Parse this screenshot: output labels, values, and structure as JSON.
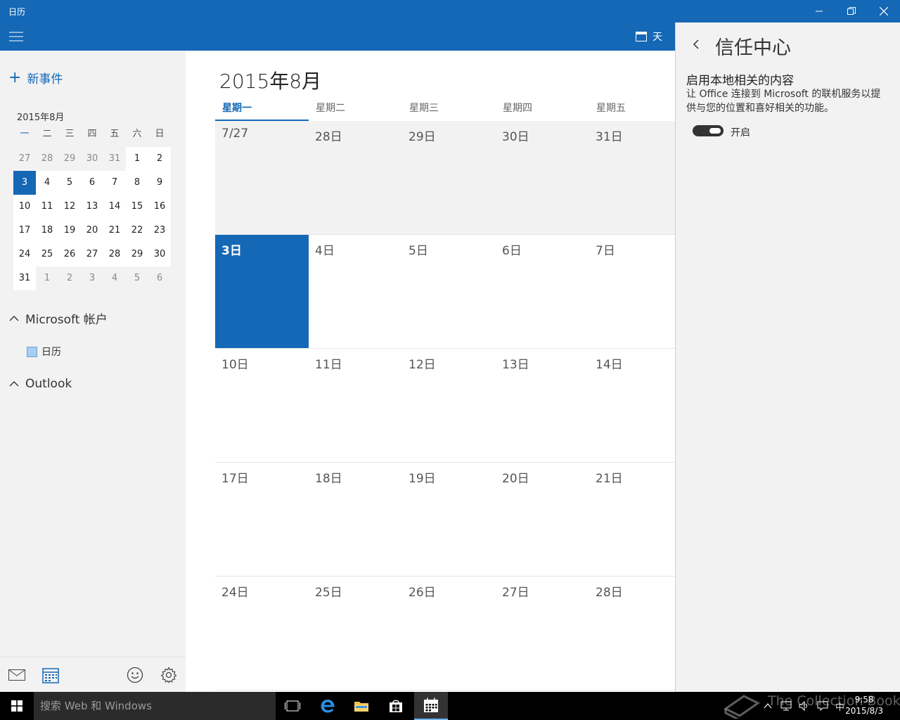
{
  "window": {
    "title": "日历"
  },
  "appbar": {
    "view_label": "天"
  },
  "sidebar": {
    "new_event": "新事件",
    "mini_calendar": {
      "title": "2015年8月",
      "weekdays": [
        "一",
        "二",
        "三",
        "四",
        "五",
        "六",
        "日"
      ],
      "days": [
        {
          "d": "27",
          "other": true
        },
        {
          "d": "28",
          "other": true
        },
        {
          "d": "29",
          "other": true
        },
        {
          "d": "30",
          "other": true
        },
        {
          "d": "31",
          "other": true
        },
        {
          "d": "1"
        },
        {
          "d": "2"
        },
        {
          "d": "3",
          "today": true
        },
        {
          "d": "4"
        },
        {
          "d": "5"
        },
        {
          "d": "6"
        },
        {
          "d": "7"
        },
        {
          "d": "8"
        },
        {
          "d": "9"
        },
        {
          "d": "10"
        },
        {
          "d": "11"
        },
        {
          "d": "12"
        },
        {
          "d": "13"
        },
        {
          "d": "14"
        },
        {
          "d": "15"
        },
        {
          "d": "16"
        },
        {
          "d": "17"
        },
        {
          "d": "18"
        },
        {
          "d": "19"
        },
        {
          "d": "20"
        },
        {
          "d": "21"
        },
        {
          "d": "22"
        },
        {
          "d": "23"
        },
        {
          "d": "24"
        },
        {
          "d": "25"
        },
        {
          "d": "26"
        },
        {
          "d": "27"
        },
        {
          "d": "28"
        },
        {
          "d": "29"
        },
        {
          "d": "30"
        },
        {
          "d": "31"
        },
        {
          "d": "1",
          "other": true
        },
        {
          "d": "2",
          "other": true
        },
        {
          "d": "3",
          "other": true
        },
        {
          "d": "4",
          "other": true
        },
        {
          "d": "5",
          "other": true
        },
        {
          "d": "6",
          "other": true
        }
      ]
    },
    "accounts": [
      {
        "label": "Microsoft 帐户",
        "calendars": [
          "日历"
        ]
      },
      {
        "label": "Outlook",
        "calendars": []
      }
    ]
  },
  "main": {
    "month_title": "2015年8月",
    "weekdays": [
      "星期一",
      "星期二",
      "星期三",
      "星期四",
      "星期五"
    ],
    "weeks": [
      [
        "7/27",
        "28日",
        "29日",
        "30日",
        "31日"
      ],
      [
        "3日",
        "4日",
        "5日",
        "6日",
        "7日"
      ],
      [
        "10日",
        "11日",
        "12日",
        "13日",
        "14日"
      ],
      [
        "17日",
        "18日",
        "19日",
        "20日",
        "21日"
      ],
      [
        "24日",
        "25日",
        "26日",
        "27日",
        "28日"
      ]
    ]
  },
  "flyout": {
    "title": "信任中心",
    "subtitle": "启用本地相关的内容",
    "description": "让 Office 连接到 Microsoft 的联机服务以提供与您的位置和喜好相关的功能。",
    "toggle_label": "开启",
    "toggle_on": true
  },
  "taskbar": {
    "search_placeholder": "搜索 Web 和 Windows",
    "time": "9:58",
    "date": "2015/8/3",
    "ime": "中",
    "watermark": "The Collection Book"
  },
  "colors": {
    "accent": "#1568b5",
    "pane": "#f2f2f2"
  }
}
